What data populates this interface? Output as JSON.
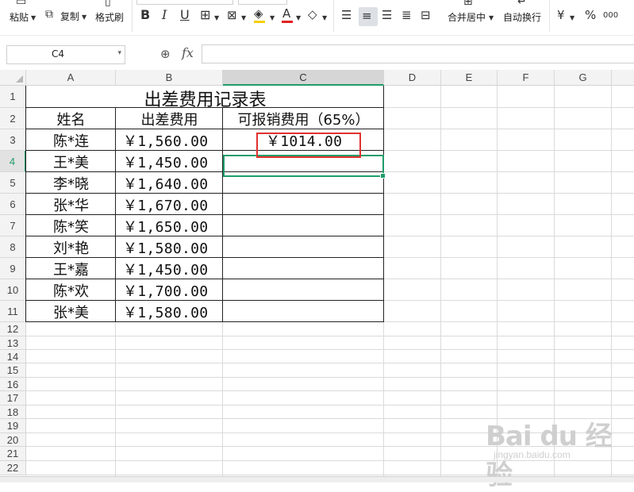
{
  "ribbon": {
    "paste_label": "粘贴",
    "copy_label": "复制",
    "format_painter_label": "格式刷",
    "bold_icon": "B",
    "italic_icon": "I",
    "underline_icon": "U",
    "merge_center_label": "合并居中",
    "wrap_text_label": "自动换行",
    "currency_icon": "¥",
    "percent_icon": "%",
    "thousands_icon": "000"
  },
  "formula_bar": {
    "name_box": "C4",
    "fx_label": "fx",
    "formula": ""
  },
  "columns": [
    "A",
    "B",
    "C",
    "D",
    "E",
    "F",
    "G"
  ],
  "selected_column": "C",
  "selected_row": "4",
  "rows": [
    "1",
    "2",
    "3",
    "4",
    "5",
    "6",
    "7",
    "8",
    "9",
    "10",
    "11",
    "12",
    "13",
    "14",
    "15",
    "16",
    "17",
    "18",
    "19",
    "20",
    "21",
    "22"
  ],
  "table": {
    "title": "出差费用记录表",
    "headers": [
      "姓名",
      "出差费用",
      "可报销费用（65%）"
    ],
    "records": [
      {
        "name": "陈*连",
        "cost": "￥1,560.00",
        "reimburse": "￥1014.00"
      },
      {
        "name": "王*美",
        "cost": "￥1,450.00",
        "reimburse": ""
      },
      {
        "name": "李*晓",
        "cost": "￥1,640.00",
        "reimburse": ""
      },
      {
        "name": "张*华",
        "cost": "￥1,670.00",
        "reimburse": ""
      },
      {
        "name": "陈*笑",
        "cost": "￥1,650.00",
        "reimburse": ""
      },
      {
        "name": "刘*艳",
        "cost": "￥1,580.00",
        "reimburse": ""
      },
      {
        "name": "王*嘉",
        "cost": "￥1,450.00",
        "reimburse": ""
      },
      {
        "name": "陈*欢",
        "cost": "￥1,700.00",
        "reimburse": ""
      },
      {
        "name": "张*美",
        "cost": "￥1,580.00",
        "reimburse": ""
      }
    ]
  },
  "watermark": {
    "logo": "Bai du 经验",
    "url": "jingyan.baidu.com"
  },
  "colors": {
    "selection": "#1f9d6a",
    "highlight": "#e0312f",
    "font_color_bar": "#e02020",
    "fill_color_bar": "#f5d000"
  }
}
